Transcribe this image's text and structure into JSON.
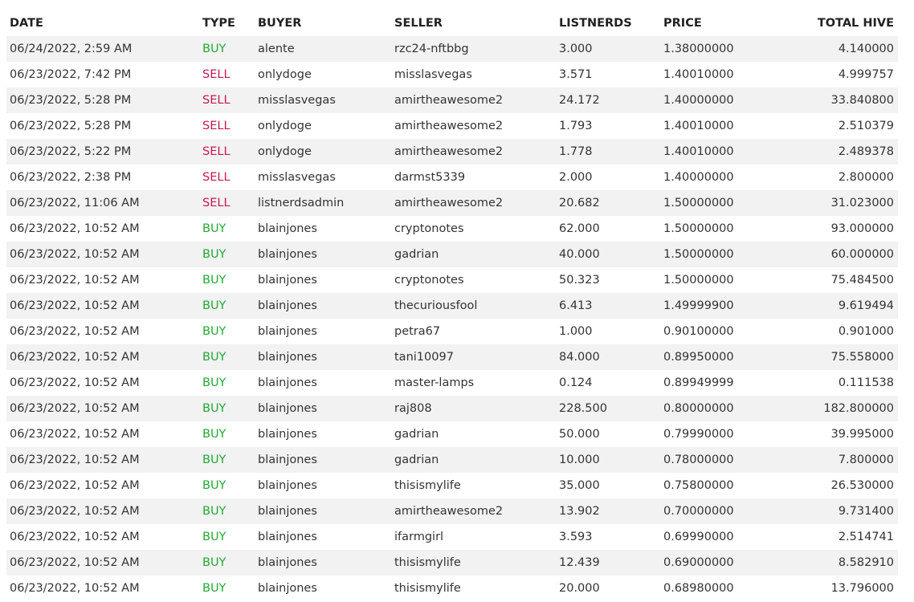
{
  "columns": {
    "date": "DATE",
    "type": "TYPE",
    "buyer": "BUYER",
    "seller": "SELLER",
    "amount": "LISTNERDS",
    "price": "PRICE",
    "total": "TOTAL HIVE"
  },
  "colors": {
    "buy": "#22a834",
    "sell": "#c8174f",
    "row_stripe": "#f2f2f2"
  },
  "rows": [
    {
      "date": "06/24/2022, 2:59 AM",
      "type": "BUY",
      "buyer": "alente",
      "seller": "rzc24-nftbbg",
      "amount": "3.000",
      "price": "1.38000000",
      "total": "4.140000"
    },
    {
      "date": "06/23/2022, 7:42 PM",
      "type": "SELL",
      "buyer": "onlydoge",
      "seller": "misslasvegas",
      "amount": "3.571",
      "price": "1.40010000",
      "total": "4.999757"
    },
    {
      "date": "06/23/2022, 5:28 PM",
      "type": "SELL",
      "buyer": "misslasvegas",
      "seller": "amirtheawesome2",
      "amount": "24.172",
      "price": "1.40000000",
      "total": "33.840800"
    },
    {
      "date": "06/23/2022, 5:28 PM",
      "type": "SELL",
      "buyer": "onlydoge",
      "seller": "amirtheawesome2",
      "amount": "1.793",
      "price": "1.40010000",
      "total": "2.510379"
    },
    {
      "date": "06/23/2022, 5:22 PM",
      "type": "SELL",
      "buyer": "onlydoge",
      "seller": "amirtheawesome2",
      "amount": "1.778",
      "price": "1.40010000",
      "total": "2.489378"
    },
    {
      "date": "06/23/2022, 2:38 PM",
      "type": "SELL",
      "buyer": "misslasvegas",
      "seller": "darmst5339",
      "amount": "2.000",
      "price": "1.40000000",
      "total": "2.800000"
    },
    {
      "date": "06/23/2022, 11:06 AM",
      "type": "SELL",
      "buyer": "listnerdsadmin",
      "seller": "amirtheawesome2",
      "amount": "20.682",
      "price": "1.50000000",
      "total": "31.023000"
    },
    {
      "date": "06/23/2022, 10:52 AM",
      "type": "BUY",
      "buyer": "blainjones",
      "seller": "cryptonotes",
      "amount": "62.000",
      "price": "1.50000000",
      "total": "93.000000"
    },
    {
      "date": "06/23/2022, 10:52 AM",
      "type": "BUY",
      "buyer": "blainjones",
      "seller": "gadrian",
      "amount": "40.000",
      "price": "1.50000000",
      "total": "60.000000"
    },
    {
      "date": "06/23/2022, 10:52 AM",
      "type": "BUY",
      "buyer": "blainjones",
      "seller": "cryptonotes",
      "amount": "50.323",
      "price": "1.50000000",
      "total": "75.484500"
    },
    {
      "date": "06/23/2022, 10:52 AM",
      "type": "BUY",
      "buyer": "blainjones",
      "seller": "thecuriousfool",
      "amount": "6.413",
      "price": "1.49999900",
      "total": "9.619494"
    },
    {
      "date": "06/23/2022, 10:52 AM",
      "type": "BUY",
      "buyer": "blainjones",
      "seller": "petra67",
      "amount": "1.000",
      "price": "0.90100000",
      "total": "0.901000"
    },
    {
      "date": "06/23/2022, 10:52 AM",
      "type": "BUY",
      "buyer": "blainjones",
      "seller": "tani10097",
      "amount": "84.000",
      "price": "0.89950000",
      "total": "75.558000"
    },
    {
      "date": "06/23/2022, 10:52 AM",
      "type": "BUY",
      "buyer": "blainjones",
      "seller": "master-lamps",
      "amount": "0.124",
      "price": "0.89949999",
      "total": "0.111538"
    },
    {
      "date": "06/23/2022, 10:52 AM",
      "type": "BUY",
      "buyer": "blainjones",
      "seller": "raj808",
      "amount": "228.500",
      "price": "0.80000000",
      "total": "182.800000"
    },
    {
      "date": "06/23/2022, 10:52 AM",
      "type": "BUY",
      "buyer": "blainjones",
      "seller": "gadrian",
      "amount": "50.000",
      "price": "0.79990000",
      "total": "39.995000"
    },
    {
      "date": "06/23/2022, 10:52 AM",
      "type": "BUY",
      "buyer": "blainjones",
      "seller": "gadrian",
      "amount": "10.000",
      "price": "0.78000000",
      "total": "7.800000"
    },
    {
      "date": "06/23/2022, 10:52 AM",
      "type": "BUY",
      "buyer": "blainjones",
      "seller": "thisismylife",
      "amount": "35.000",
      "price": "0.75800000",
      "total": "26.530000"
    },
    {
      "date": "06/23/2022, 10:52 AM",
      "type": "BUY",
      "buyer": "blainjones",
      "seller": "amirtheawesome2",
      "amount": "13.902",
      "price": "0.70000000",
      "total": "9.731400"
    },
    {
      "date": "06/23/2022, 10:52 AM",
      "type": "BUY",
      "buyer": "blainjones",
      "seller": "ifarmgirl",
      "amount": "3.593",
      "price": "0.69990000",
      "total": "2.514741"
    },
    {
      "date": "06/23/2022, 10:52 AM",
      "type": "BUY",
      "buyer": "blainjones",
      "seller": "thisismylife",
      "amount": "12.439",
      "price": "0.69000000",
      "total": "8.582910"
    },
    {
      "date": "06/23/2022, 10:52 AM",
      "type": "BUY",
      "buyer": "blainjones",
      "seller": "thisismylife",
      "amount": "20.000",
      "price": "0.68980000",
      "total": "13.796000"
    }
  ]
}
